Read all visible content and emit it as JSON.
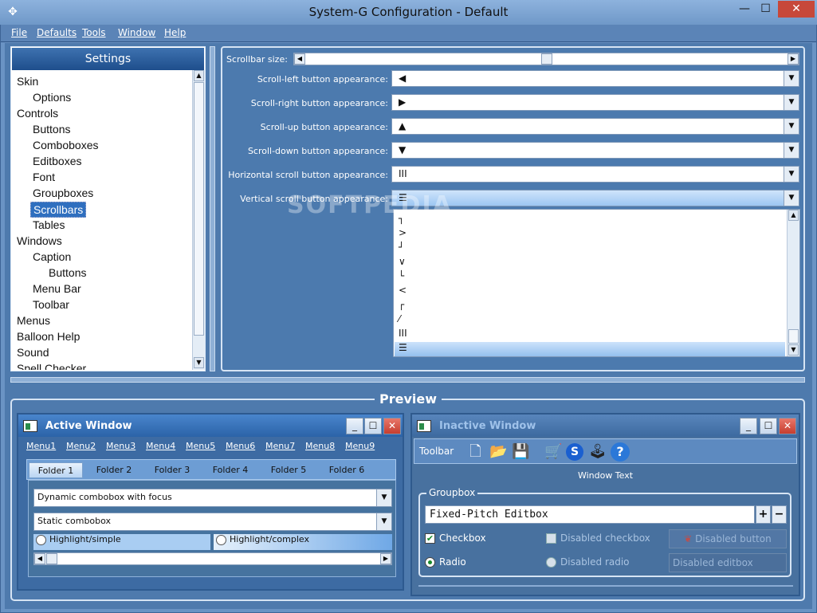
{
  "window": {
    "title": "System-G Configuration - Default",
    "app_icon": "✥",
    "min_glyph": "—",
    "max_glyph": "☐",
    "close_glyph": "✕"
  },
  "menubar": [
    "File",
    "Defaults",
    "Tools",
    "Window",
    "Help"
  ],
  "settings": {
    "header": "Settings",
    "tree": [
      {
        "label": "Skin",
        "level": 0
      },
      {
        "label": "Options",
        "level": 1
      },
      {
        "label": "Controls",
        "level": 0
      },
      {
        "label": "Buttons",
        "level": 1
      },
      {
        "label": "Comboboxes",
        "level": 1
      },
      {
        "label": "Editboxes",
        "level": 1
      },
      {
        "label": "Font",
        "level": 1
      },
      {
        "label": "Groupboxes",
        "level": 1
      },
      {
        "label": "Scrollbars",
        "level": 1,
        "selected": true
      },
      {
        "label": "Tables",
        "level": 1
      },
      {
        "label": "Windows",
        "level": 0
      },
      {
        "label": "Caption",
        "level": 1
      },
      {
        "label": "Buttons",
        "level": 2
      },
      {
        "label": "Menu Bar",
        "level": 1
      },
      {
        "label": "Toolbar",
        "level": 1
      },
      {
        "label": "Menus",
        "level": 0
      },
      {
        "label": "Balloon Help",
        "level": 0
      },
      {
        "label": "Sound",
        "level": 0
      },
      {
        "label": "Spell Checker",
        "level": 0
      }
    ]
  },
  "scrollbar_settings": {
    "size_label": "Scrollbar size:",
    "rows": [
      {
        "label": "Scroll-left button appearance:",
        "glyph": "◀"
      },
      {
        "label": "Scroll-right button appearance:",
        "glyph": "▶"
      },
      {
        "label": "Scroll-up button appearance:",
        "glyph": "▲"
      },
      {
        "label": "Scroll-down button appearance:",
        "glyph": "▼"
      },
      {
        "label": "Horizontal scroll button appearance:",
        "glyph": "III"
      },
      {
        "label": "Vertical scroll button appearance:",
        "glyph": "☰"
      }
    ],
    "dropdown_options": [
      "┐",
      ">",
      "┘",
      "∨",
      "└",
      "<",
      "┌",
      "⁄",
      "III",
      "☰"
    ]
  },
  "watermark": "SOFTPEDIA",
  "preview": {
    "title": "Preview",
    "active": {
      "title": "Active Window",
      "menus": [
        "Menu1",
        "Menu2",
        "Menu3",
        "Menu4",
        "Menu5",
        "Menu6",
        "Menu7",
        "Menu8",
        "Menu9"
      ],
      "tabs": [
        "Folder 1",
        "Folder 2",
        "Folder 3",
        "Folder 4",
        "Folder 5",
        "Folder 6"
      ],
      "combo_focus": "Dynamic combobox with focus",
      "combo_static": "Static combobox",
      "radio_simple": "Highlight/simple",
      "radio_complex": "Highlight/complex"
    },
    "inactive": {
      "title": "Inactive Window",
      "toolbar_label": "Toolbar",
      "window_text": "Window Text",
      "groupbox_title": "Groupbox",
      "edit_value": "Fixed-Pitch Editbox",
      "checkbox": "Checkbox",
      "disabled_checkbox": "Disabled checkbox",
      "disabled_button": "Disabled button",
      "radio": "Radio",
      "disabled_radio": "Disabled radio",
      "disabled_editbox": "Disabled editbox"
    }
  },
  "colors": {
    "accent": "#2f6fbf",
    "background": "#4e7aad",
    "close_red": "#c63d2e"
  }
}
